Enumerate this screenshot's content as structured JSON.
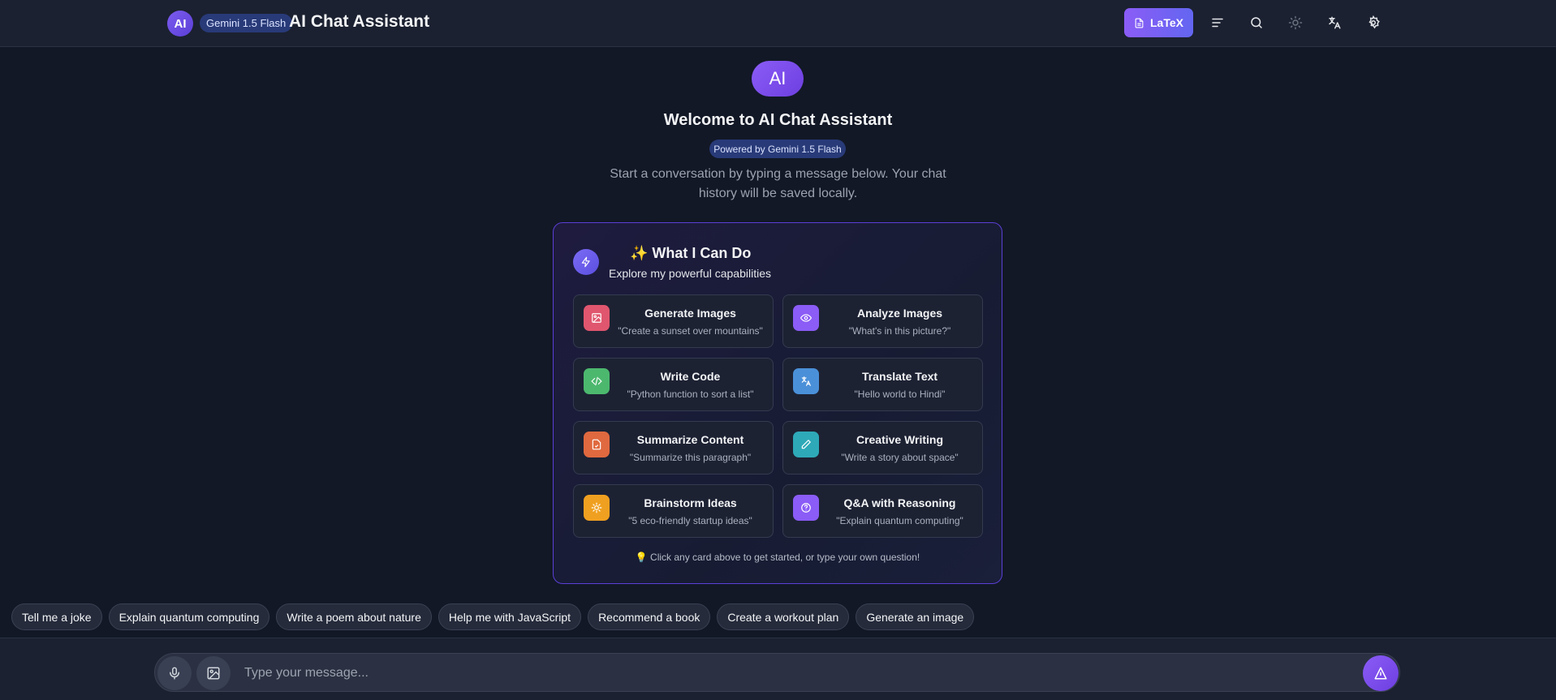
{
  "header": {
    "logo_text": "AI",
    "model_badge": "Gemini 1.5 Flash",
    "title": "AI Chat Assistant",
    "latex_label": "LaTeX",
    "icons": [
      "menu-icon",
      "search-icon",
      "sun-icon",
      "translate-icon",
      "gear-icon"
    ]
  },
  "welcome": {
    "avatar_text": "AI",
    "title": "Welcome to AI Chat Assistant",
    "powered_by": "Powered by Gemini 1.5 Flash",
    "intro": "Start a conversation by typing a message below. Your chat history will be saved locally."
  },
  "capabilities": {
    "title": "✨ What I Can Do",
    "subtitle": "Explore my powerful capabilities",
    "cards": [
      {
        "title": "Generate Images",
        "example": "\"Create a sunset over mountains\"",
        "icon": "image-icon",
        "color": "#e0566e"
      },
      {
        "title": "Analyze Images",
        "example": "\"What's in this picture?\"",
        "icon": "eye-icon",
        "color": "#8b5cf6"
      },
      {
        "title": "Write Code",
        "example": "\"Python function to sort a list\"",
        "icon": "code-icon",
        "color": "#4cb86e"
      },
      {
        "title": "Translate Text",
        "example": "\"Hello world to Hindi\"",
        "icon": "translate-icon",
        "color": "#4a90d9"
      },
      {
        "title": "Summarize Content",
        "example": "\"Summarize this paragraph\"",
        "icon": "document-icon",
        "color": "#e0693f"
      },
      {
        "title": "Creative Writing",
        "example": "\"Write a story about space\"",
        "icon": "pen-icon",
        "color": "#2ea9b8"
      },
      {
        "title": "Brainstorm Ideas",
        "example": "\"5 eco-friendly startup ideas\"",
        "icon": "lightbulb-icon",
        "color": "#f0a020"
      },
      {
        "title": "Q&A with Reasoning",
        "example": "\"Explain quantum computing\"",
        "icon": "help-circle-icon",
        "color": "#8b5cf6"
      }
    ],
    "hint": "💡 Click any card above to get started, or type your own question!"
  },
  "suggestions": [
    "Tell me a joke",
    "Explain quantum computing",
    "Write a poem about nature",
    "Help me with JavaScript",
    "Recommend a book",
    "Create a workout plan",
    "Generate an image"
  ],
  "composer": {
    "placeholder": "Type your message..."
  },
  "colors": {
    "background": "#121826",
    "accent": "#8b5cf6",
    "header": "#1b2130"
  }
}
